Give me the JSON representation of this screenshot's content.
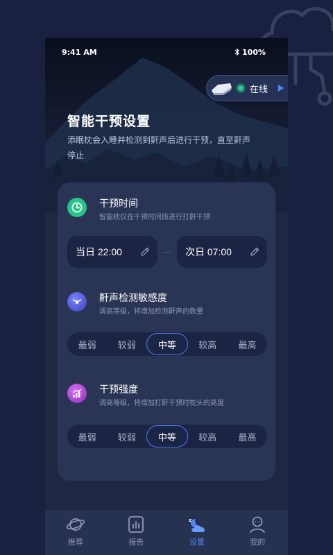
{
  "status_bar": {
    "time": "9:41 AM",
    "battery": "100%"
  },
  "device": {
    "status": "在线"
  },
  "header": {
    "title": "智能干预设置",
    "description": "添眠枕会入睡并检测到鼾声后进行干预，直至鼾声停止"
  },
  "intervention_time": {
    "title": "干预时间",
    "subtitle": "智能枕仅在干预时间段进行打鼾干预",
    "start": "当日 22:00",
    "end": "次日 07:00"
  },
  "sensitivity": {
    "title": "鼾声检测敏感度",
    "subtitle": "调高等级，将增加检测鼾声的数量",
    "options": [
      "最弱",
      "较弱",
      "中等",
      "较高",
      "最高"
    ],
    "selected": "中等"
  },
  "intensity": {
    "title": "干预强度",
    "subtitle": "调高等级，将增加打鼾干预时枕头的高度",
    "options": [
      "最弱",
      "较弱",
      "中等",
      "较高",
      "最高"
    ],
    "selected": "中等"
  },
  "tabbar": {
    "items": [
      {
        "label": "推荐",
        "icon": "planet-icon"
      },
      {
        "label": "报告",
        "icon": "report-icon"
      },
      {
        "label": "设置",
        "icon": "moon-cloud-icon"
      },
      {
        "label": "我的",
        "icon": "user-icon"
      }
    ],
    "active": "设置"
  },
  "colors": {
    "background": "#1a2040",
    "card": "#2a3454",
    "accent_blue": "#4f7ef5",
    "online_green": "#2ec79b",
    "time_icon_green": "#27c48a",
    "sensitivity_icon": "#4a56d8",
    "intensity_icon": "#b24ad8"
  }
}
